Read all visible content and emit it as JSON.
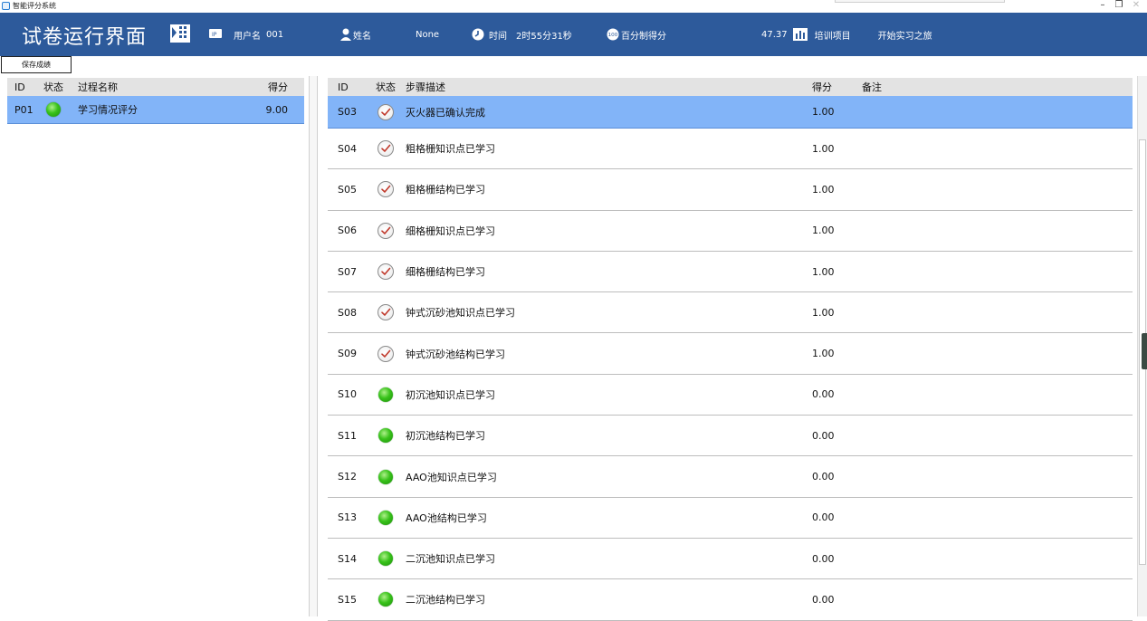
{
  "window": {
    "title": "智能评分系统",
    "minimize_glyph": "–",
    "restore_glyph": "❐",
    "close_glyph": "✕"
  },
  "header": {
    "page_title": "试卷运行界面",
    "user_label": "用户名",
    "user_value": "001",
    "name_label": "姓名",
    "name_value": "None",
    "time_label": "时间",
    "time_value": "2时55分31秒",
    "score_label": "百分制得分",
    "score_value": "47.37",
    "project_label": "培训项目",
    "project_value": "开始实习之旅",
    "icons": [
      "grid-icon",
      "ip-icon",
      "person-icon",
      "clock-icon",
      "hundred-badge-icon",
      "bar-chart-icon"
    ],
    "accent_color": "#2d5a9b"
  },
  "toolbar": {
    "save_label": "保存成绩"
  },
  "processes": {
    "columns": [
      "ID",
      "状态",
      "过程名称",
      "得分"
    ],
    "rows": [
      {
        "id": "P01",
        "status": "green",
        "name": "学习情况评分",
        "score": "9.00",
        "selected": true
      }
    ]
  },
  "steps": {
    "columns": [
      "ID",
      "状态",
      "步骤描述",
      "得分",
      "备注"
    ],
    "rows": [
      {
        "id": "S03",
        "status": "check",
        "desc": "灭火器已确认完成",
        "score": "1.00",
        "note": "",
        "selected": true
      },
      {
        "id": "S04",
        "status": "check",
        "desc": "粗格栅知识点已学习",
        "score": "1.00",
        "note": ""
      },
      {
        "id": "S05",
        "status": "check",
        "desc": "粗格栅结构已学习",
        "score": "1.00",
        "note": ""
      },
      {
        "id": "S06",
        "status": "check",
        "desc": "细格栅知识点已学习",
        "score": "1.00",
        "note": ""
      },
      {
        "id": "S07",
        "status": "check",
        "desc": "细格栅结构已学习",
        "score": "1.00",
        "note": ""
      },
      {
        "id": "S08",
        "status": "check",
        "desc": "钟式沉砂池知识点已学习",
        "score": "1.00",
        "note": ""
      },
      {
        "id": "S09",
        "status": "check",
        "desc": "钟式沉砂池结构已学习",
        "score": "1.00",
        "note": ""
      },
      {
        "id": "S10",
        "status": "green",
        "desc": "初沉池知识点已学习",
        "score": "0.00",
        "note": ""
      },
      {
        "id": "S11",
        "status": "green",
        "desc": "初沉池结构已学习",
        "score": "0.00",
        "note": ""
      },
      {
        "id": "S12",
        "status": "green",
        "desc": "AAO池知识点已学习",
        "score": "0.00",
        "note": ""
      },
      {
        "id": "S13",
        "status": "green",
        "desc": "AAO池结构已学习",
        "score": "0.00",
        "note": ""
      },
      {
        "id": "S14",
        "status": "green",
        "desc": "二沉池知识点已学习",
        "score": "0.00",
        "note": ""
      },
      {
        "id": "S15",
        "status": "green",
        "desc": "二沉池结构已学习",
        "score": "0.00",
        "note": ""
      }
    ]
  },
  "colors": {
    "selected_row": "#82b4f8",
    "status_done": "#8a8a8a",
    "status_pending": "#38c21a"
  }
}
